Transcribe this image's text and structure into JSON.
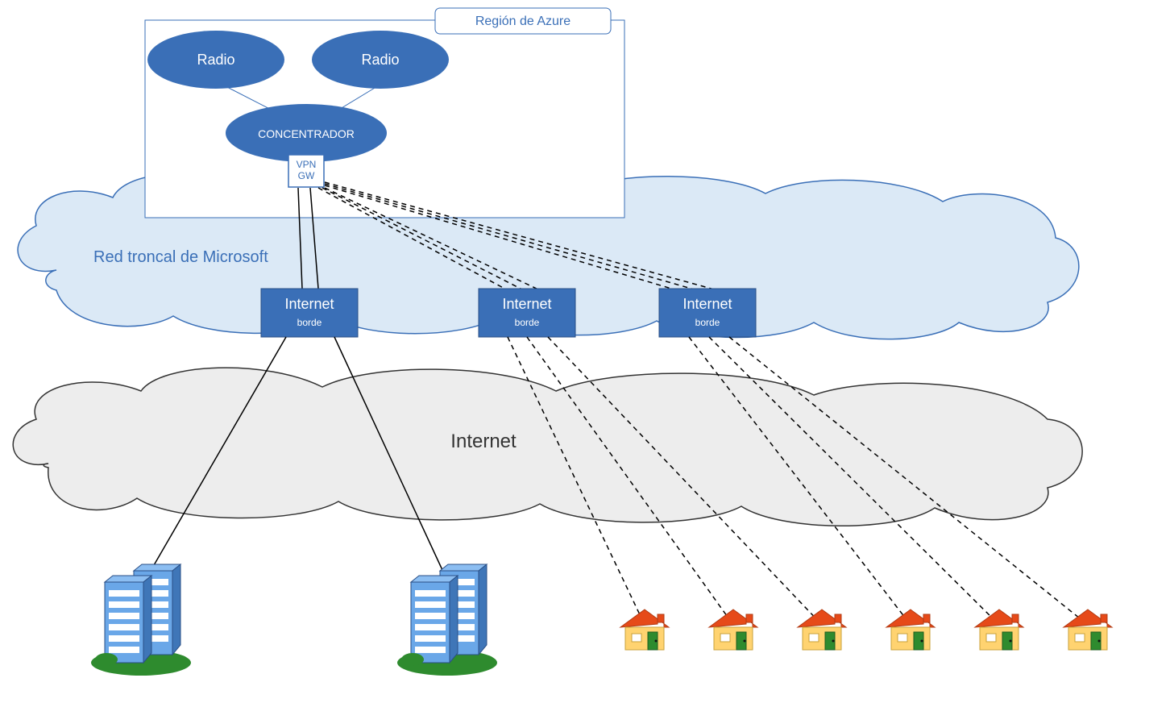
{
  "diagram": {
    "azure_region_label": "Región de Azure",
    "spoke_left": "Radio",
    "spoke_right": "Radio",
    "hub": "CONCENTRADOR",
    "vpn_gw_line1": "VPN",
    "vpn_gw_line2": "GW",
    "backbone_label": "Red troncal de Microsoft",
    "edge1_title": "Internet",
    "edge1_sub": "borde",
    "edge2_title": "Internet",
    "edge2_sub": "borde",
    "edge3_title": "Internet",
    "edge3_sub": "borde",
    "internet_label": "Internet"
  }
}
